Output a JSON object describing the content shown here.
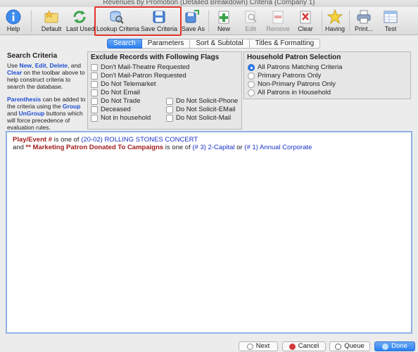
{
  "window": {
    "title": "Revenues by Promotion (Detailed Breakdown) Criteria {Company 1}"
  },
  "toolbar": {
    "help": "Help",
    "default": "Default",
    "last_used": "Last Used",
    "lookup_criteria": "Lookup Criteria",
    "save_criteria": "Save Criteria",
    "save_as": "Save As",
    "new": "New",
    "edit": "Edit",
    "remove": "Remove",
    "clear": "Clear",
    "having": "Having",
    "print": "Print...",
    "test": "Test"
  },
  "tabs": [
    "Search",
    "Parameters",
    "Sort & Subtotal",
    "Titles & Formatting"
  ],
  "search_criteria": {
    "title": "Search Criteria",
    "p1_use": "Use ",
    "kw_new": "New",
    "kw_edit": "Edit",
    "kw_delete": "Delete",
    "kw_clear": "Clear",
    "p1_comma": ", ",
    "p1_and": ", and ",
    "p1_rest": " on the toolbar above to help construct criteria to search the database.",
    "kw_parenthesis": "Parenthesis",
    "p2_a": " can be added to the criteria using the ",
    "kw_group": "Group",
    "p2_b": " and ",
    "kw_ungroup": "UnGroup",
    "p2_c": " buttons which will force precedence of evaluation rules."
  },
  "exclude_flags": {
    "title": "Exclude Records with Following Flags",
    "left": [
      "Don't Mail-Theatre Requested",
      "Don't Mail-Patron Requested",
      "Do Not Telemarket",
      "Do Not Email",
      "Do Not Trade",
      "Deceased",
      "Not in household"
    ],
    "right": [
      "Do Not Solicit-Phone",
      "Do Not Solicit-EMail",
      "Do Not Solicit-Mail"
    ]
  },
  "household": {
    "title": "Household Patron Selection",
    "options": [
      "All Patrons Matching Criteria",
      "Primary Patrons Only",
      "Non-Primary Patrons Only",
      "All Patrons in Household"
    ],
    "selected": "All Patrons Matching Criteria"
  },
  "criteria": {
    "line1_field": "Play/Event #",
    "line1_op": " is one of ",
    "line1_value": "(20-02) ROLLING STONES CONCERT",
    "line2_and": "and ",
    "line2_field": "** Marketing Patron Donated To Campaigns",
    "line2_op": " is one of ",
    "line2_value1": "(# 3) 2-Capital",
    "line2_or": " or ",
    "line2_value2": "(# 1) Annual Corporate"
  },
  "footer": {
    "next": "Next",
    "cancel": "Cancel",
    "queue": "Queue",
    "done": "Done"
  },
  "colors": {
    "accent": "#2c7ef0",
    "highlight": "#e0352b",
    "field": "#a11d1d",
    "value": "#1b34c9"
  }
}
